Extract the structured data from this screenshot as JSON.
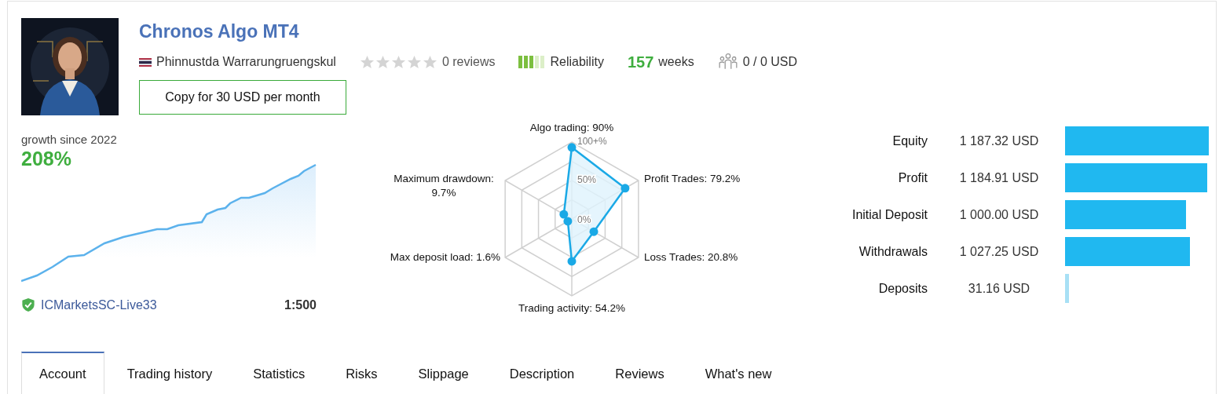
{
  "title": "Chronos Algo MT4",
  "author": {
    "name": "Phinnustda Warrarungruengskul"
  },
  "rating": {
    "stars": 0,
    "reviews": "0 reviews"
  },
  "reliability": {
    "label": "Reliability",
    "level": 0.6
  },
  "age": {
    "number": "157",
    "unit": "weeks"
  },
  "subscribers": "0 / 0 USD",
  "copy_button": "Copy for 30 USD per month",
  "growth": {
    "caption": "growth since 2022",
    "value": "208%"
  },
  "server": {
    "name": "ICMarketsSC-Live33",
    "leverage": "1:500",
    "verified": true
  },
  "radar": {
    "scale": [
      "100+%",
      "50%",
      "0%"
    ],
    "axes": [
      {
        "lines": [
          "Algo trading: 90%"
        ]
      },
      {
        "lines": [
          "Maximum drawdown:",
          "9.7%"
        ]
      },
      {
        "lines": [
          "Profit Trades: 79.2%"
        ]
      },
      {
        "lines": [
          "Max deposit load: 1.6%"
        ]
      },
      {
        "lines": [
          "Loss Trades: 20.8%"
        ]
      },
      {
        "lines": [
          "Trading activity: 54.2%"
        ]
      }
    ]
  },
  "stats": [
    {
      "label": "Equity",
      "value": "1 187.32 USD",
      "color": "#20b8f0"
    },
    {
      "label": "Profit",
      "value": "1 184.91 USD",
      "color": "#20b8f0"
    },
    {
      "label": "Initial Deposit",
      "value": "1 000.00 USD",
      "color": "#20b8f0"
    },
    {
      "label": "Withdrawals",
      "value": "1 027.25 USD",
      "color": "#20b8f0"
    },
    {
      "label": "Deposits",
      "value": "31.16 USD",
      "color": "#a8e0f5"
    }
  ],
  "tabs": [
    {
      "label": "Account",
      "selected": true
    },
    {
      "label": "Trading history",
      "selected": false
    },
    {
      "label": "Statistics",
      "selected": false
    },
    {
      "label": "Risks",
      "selected": false
    },
    {
      "label": "Slippage",
      "selected": false
    },
    {
      "label": "Description",
      "selected": false
    },
    {
      "label": "Reviews",
      "selected": false
    },
    {
      "label": "What's new",
      "selected": false
    }
  ]
}
